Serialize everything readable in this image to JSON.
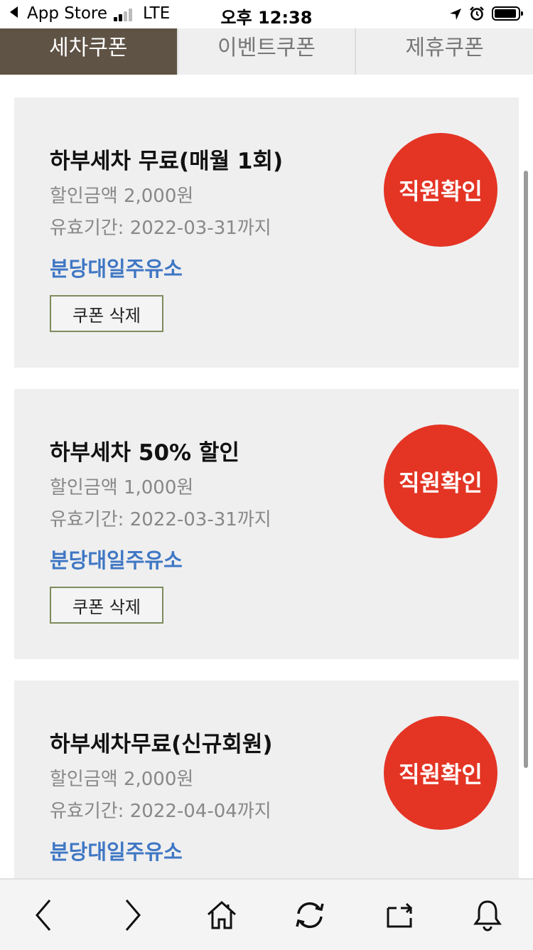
{
  "status_bar": {
    "back_app": "App Store",
    "network": "LTE",
    "time": "오후 12:38"
  },
  "tabs": [
    {
      "label": "세차쿠폰",
      "active": true
    },
    {
      "label": "이벤트쿠폰",
      "active": false
    },
    {
      "label": "제휴쿠폰",
      "active": false
    }
  ],
  "coupons": [
    {
      "title": "하부세차 무료(매월 1회)",
      "amount": "할인금액 2,000원",
      "expiry": "유효기간: 2022-03-31까지",
      "store": "분당대일주유소",
      "delete_label": "쿠폰 삭제",
      "confirm_label": "직원확인"
    },
    {
      "title": "하부세차 50% 할인",
      "amount": "할인금액 1,000원",
      "expiry": "유효기간: 2022-03-31까지",
      "store": "분당대일주유소",
      "delete_label": "쿠폰 삭제",
      "confirm_label": "직원확인"
    },
    {
      "title": "하부세차무료(신규회원)",
      "amount": "할인금액 2,000원",
      "expiry": "유효기간: 2022-04-04까지",
      "store": "분당대일주유소",
      "confirm_label": "직원확인"
    }
  ],
  "bottom_nav": [
    {
      "icon": "back-arrow-icon"
    },
    {
      "icon": "forward-arrow-icon"
    },
    {
      "icon": "home-icon"
    },
    {
      "icon": "refresh-icon"
    },
    {
      "icon": "share-icon"
    },
    {
      "icon": "bell-icon"
    }
  ],
  "colors": {
    "tab_active_bg": "#5f5345",
    "badge_red": "#e43424",
    "store_blue": "#3f77c4",
    "card_bg": "#efefef"
  }
}
